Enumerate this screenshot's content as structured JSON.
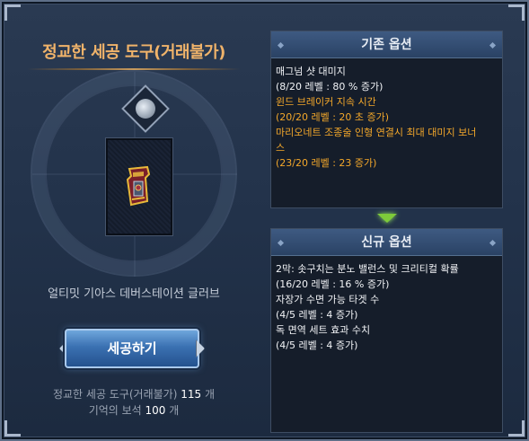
{
  "left": {
    "title": "정교한 세공 도구(거래불가)",
    "item_name": "얼티밋 기아스 데버스테이션 글러브",
    "craft_button": "세공하기",
    "cost": [
      {
        "label": "정교한 세공 도구(거래불가)",
        "count": "115",
        "unit": "개"
      },
      {
        "label": "기억의 보석",
        "count": "100",
        "unit": "개"
      }
    ]
  },
  "existing": {
    "header": "기존 옵션",
    "lines": [
      {
        "text": "매그넘 샷 대미지",
        "color": "white"
      },
      {
        "text": "(8/20 레벨 : 80 % 증가)",
        "color": "white"
      },
      {
        "text": "윈드 브레이커 지속 시간",
        "color": "gold"
      },
      {
        "text": "(20/20 레벨 : 20 초 증가)",
        "color": "gold"
      },
      {
        "text": "마리오네트 조종술 인형 연결시 최대 대미지 보너",
        "color": "gold"
      },
      {
        "text": "스",
        "color": "gold"
      },
      {
        "text": "(23/20 레벨 : 23 증가)",
        "color": "gold"
      }
    ]
  },
  "new": {
    "header": "신규 옵션",
    "lines": [
      {
        "text": "2막: 솟구치는 분노 밸런스 및 크리티컬 확률",
        "color": "white"
      },
      {
        "text": "(16/20 레벨 : 16 % 증가)",
        "color": "white"
      },
      {
        "text": "자장가 수면 가능 타겟 수",
        "color": "white"
      },
      {
        "text": "(4/5 레벨 : 4 증가)",
        "color": "white"
      },
      {
        "text": "독 면역 세트 효과 수치",
        "color": "white"
      },
      {
        "text": "(4/5 레벨 : 4 증가)",
        "color": "white"
      }
    ]
  },
  "colors": {
    "title": "#f0b36a",
    "gold_text": "#f4a82a",
    "button": "#3b71b2",
    "arrow": "#7ecb3a"
  }
}
